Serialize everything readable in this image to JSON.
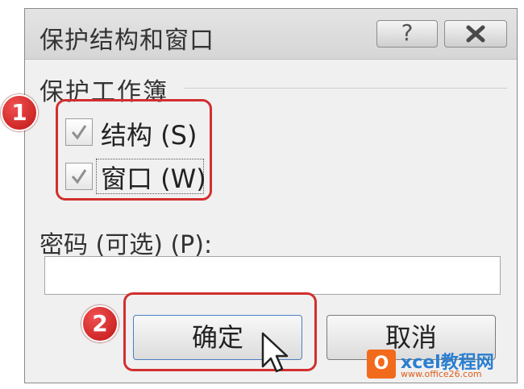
{
  "dialog": {
    "title": "保护结构和窗口",
    "help_label": "?",
    "group_label": "保护工作簿",
    "options": [
      {
        "label": "结构 (S)",
        "checked": true
      },
      {
        "label": "窗口 (W)",
        "checked": true
      }
    ],
    "password_label": "密码 (可选) (P):",
    "password_value": "",
    "ok_label": "确定",
    "cancel_label": "取消"
  },
  "callouts": {
    "step1": "1",
    "step2": "2",
    "color": "#d22f2f"
  },
  "watermark": {
    "logo": "O",
    "brand": "xcel教程网",
    "url": "www.office26.com"
  },
  "icons": [
    "help-icon",
    "close-icon",
    "checkmark-icon",
    "mouse-cursor-icon"
  ]
}
